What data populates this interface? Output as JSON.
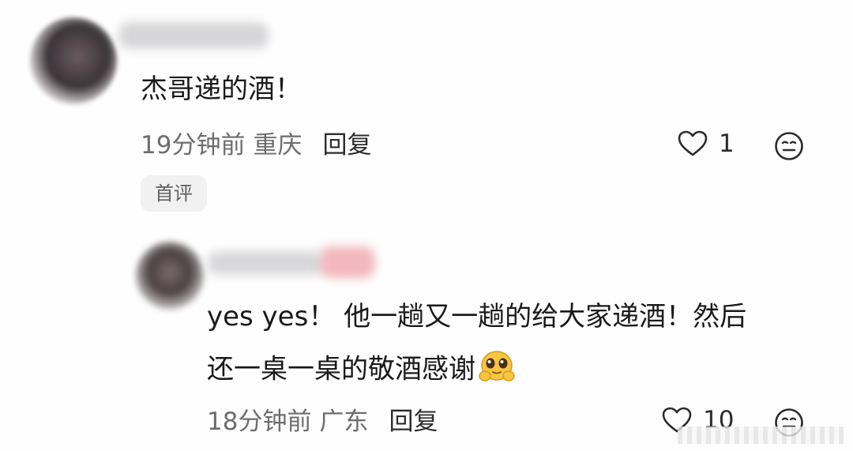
{
  "comments": [
    {
      "text": "杰哥递的酒！",
      "time": "19分钟前",
      "location": "重庆",
      "reply_label": "回复",
      "likes": "1",
      "badge": "首评"
    },
    {
      "text_line1": "yes yes！ 他一趟又一趟的给大家递酒！然后",
      "text_line2": "还一桌一桌的敬酒感谢",
      "time": "18分钟前",
      "location": "广东",
      "reply_label": "回复",
      "likes": "10"
    }
  ],
  "icons": {
    "like": "heart-outline-icon",
    "more": "neutral-face-icon",
    "emoji": "pleading-face-emoji"
  },
  "colors": {
    "text": "#1a1a1a",
    "meta": "#6d6d6d",
    "badge_bg": "#f1f1f1"
  }
}
